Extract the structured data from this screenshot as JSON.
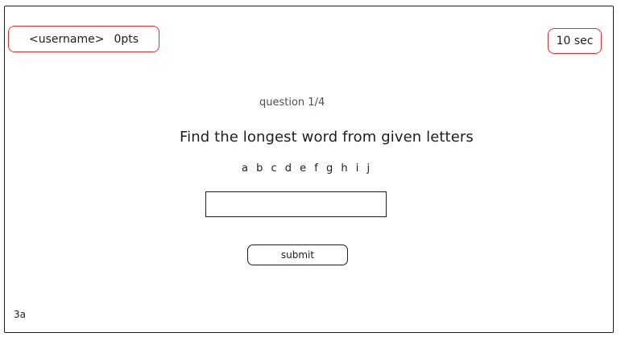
{
  "header": {
    "username": "<username>",
    "points": "0pts",
    "timer": "10 sec"
  },
  "quiz": {
    "counter": "question 1/4",
    "prompt": "Find the longest word from given letters",
    "letters": "a b c d e f g h i j",
    "answer_value": "",
    "answer_placeholder": "",
    "submit_label": "submit"
  },
  "screen_label": "3a",
  "colors": {
    "accent_border": "#e03131",
    "ink": "#1e1e1e",
    "muted": "#495057"
  }
}
